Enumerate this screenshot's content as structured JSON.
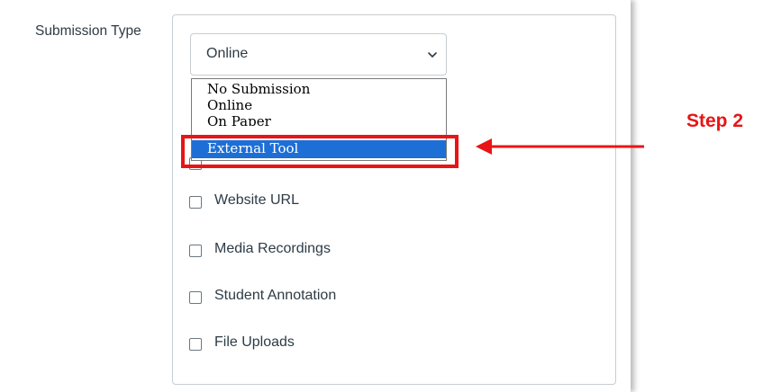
{
  "field_label": "Submission Type",
  "select": {
    "value": "Online",
    "icon": "chevron-down-icon"
  },
  "dropdown": {
    "options": [
      "No Submission",
      "Online",
      "On Paper"
    ],
    "selected": "External Tool"
  },
  "annotation": {
    "step_label": "Step 2",
    "color": "#e81416"
  },
  "online_entry_options": [
    "Website URL",
    "Media Recordings",
    "Student Annotation",
    "File Uploads"
  ],
  "colors": {
    "text": "#2d3b45",
    "border": "#c7cdd1",
    "selection": "#1d6fd6"
  }
}
